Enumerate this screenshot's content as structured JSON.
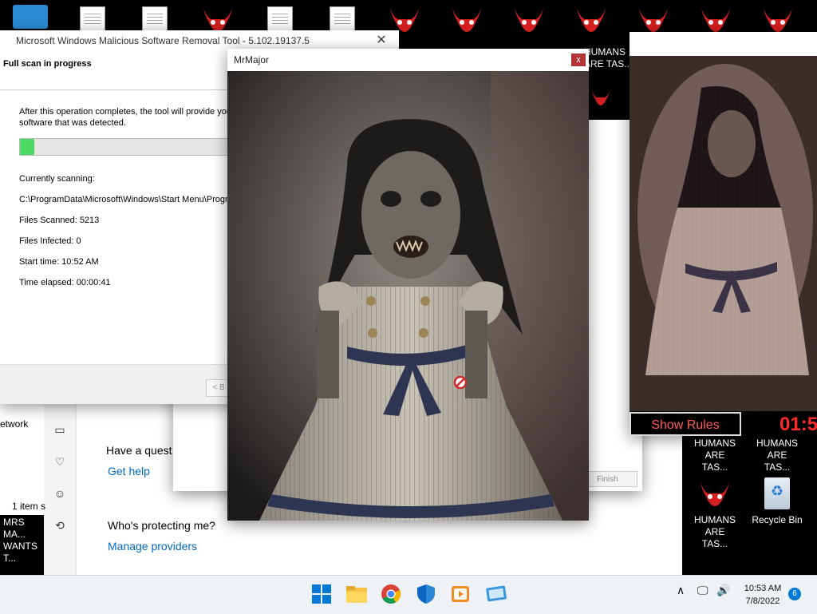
{
  "desktop": {
    "icons": [
      {
        "label": "HUMANS ARE TAS...",
        "kind": "devil"
      },
      {
        "label": "HUMANS ARE TAS...",
        "kind": "devil"
      },
      {
        "label": "HUMANS ARE TAS...",
        "kind": "devil"
      },
      {
        "label": "HUMANS ARE TAS...",
        "kind": "devil"
      },
      {
        "label": "Recycle Bin",
        "kind": "recycle"
      }
    ],
    "partial_labels": {
      "top_right_1": "HUMANS",
      "top_right_2": "ARE TAS...",
      "left_bottom_1": "MRS MA...",
      "left_bottom_2": "WANTS T..."
    }
  },
  "msrt": {
    "title": "Microsoft Windows Malicious Software Removal Tool - 5.102.19137.5",
    "header": "Full scan in progress",
    "description": "After this operation completes, the tool will provide you with a report of the malicious software that was detected.",
    "progress_percent": 4,
    "currently_scanning_label": "Currently scanning:",
    "current_path": "C:\\ProgramData\\Microsoft\\Windows\\Start Menu\\Programs\\Windows Accessories\\Immersive...",
    "files_scanned": "Files Scanned: 5213",
    "files_infected": "Files Infected: 0",
    "start_time": "Start time: 10:52 AM",
    "time_elapsed": "Time elapsed: 00:00:41",
    "back_button": "< B",
    "finish_button": "Finish"
  },
  "mrmajor": {
    "title": "MrMajor",
    "close": "x"
  },
  "winsec": {
    "network_label": "etwork",
    "items_label": "1 item s",
    "question": "Have a quest",
    "get_help": "Get help",
    "who_protecting": "Who's protecting me?",
    "manage_providers": "Manage providers"
  },
  "rightwin": {
    "show_rules": "Show Rules",
    "timer": "01:5"
  },
  "taskbar": {
    "time": "10:53 AM",
    "date": "7/8/2022",
    "notifications": "6"
  },
  "colors": {
    "progress": "#4cd964",
    "link": "#0067c0",
    "timer": "#ff2a2a",
    "win_blue": "#0078d4"
  }
}
